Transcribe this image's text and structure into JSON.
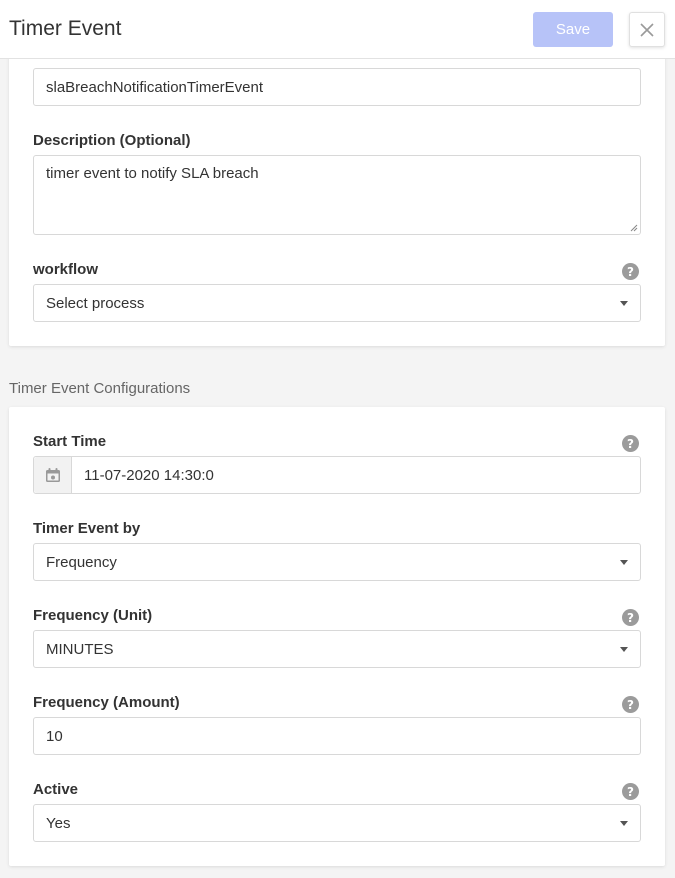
{
  "header": {
    "title": "Timer Event",
    "save_label": "Save",
    "close_icon": "close-icon"
  },
  "general": {
    "name_value": "slaBreachNotificationTimerEvent",
    "description_label": "Description (Optional)",
    "description_value": "timer event to notify SLA breach",
    "workflow_label": "workflow",
    "workflow_value": "Select process"
  },
  "timer_config": {
    "section_title": "Timer Event Configurations",
    "start_time_label": "Start Time",
    "start_time_value": "11-07-2020 14:30:0",
    "timer_by_label": "Timer Event by",
    "timer_by_value": "Frequency",
    "frequency_unit_label": "Frequency (Unit)",
    "frequency_unit_value": "MINUTES",
    "frequency_amount_label": "Frequency (Amount)",
    "frequency_amount_value": "10",
    "active_label": "Active",
    "active_value": "Yes"
  },
  "icons": {
    "help": "help-circle-icon",
    "calendar": "calendar-icon",
    "dropdown": "chevron-down-icon"
  },
  "colors": {
    "save_button": "#b7c3f8",
    "help_icon": "#9b9b9b",
    "background": "#f4f4f4"
  }
}
